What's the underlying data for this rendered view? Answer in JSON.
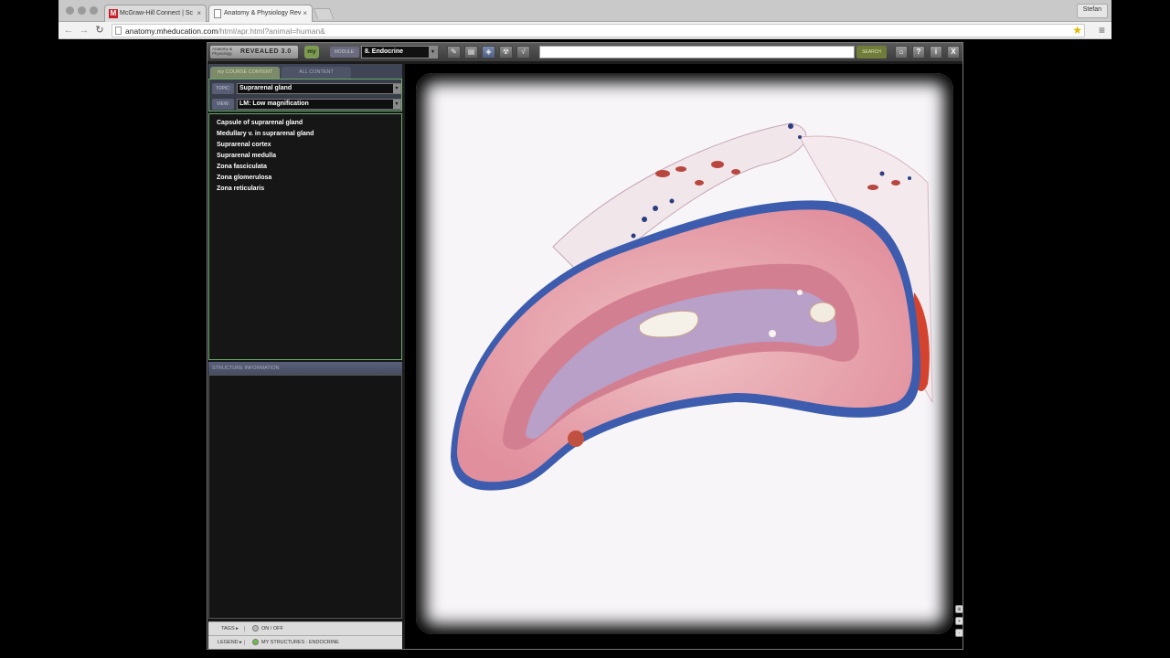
{
  "browser": {
    "tabs": [
      {
        "favicon": "M",
        "title": "McGraw-Hill Connect | Sc"
      },
      {
        "favicon": "page-icon",
        "title": "Anatomy & Physiology Rev"
      }
    ],
    "tab_close": "×",
    "user": "Stefan",
    "url_host": "anatomy.mheducation.com",
    "url_path": "/html/apr.html?animal=human&"
  },
  "app": {
    "logo_small": "Anatomy & Physiology",
    "logo_text": "REVEALED 3.0",
    "my_label": "my",
    "module_label": "MODULE:",
    "module_value": "8. Endocrine",
    "search_value": "",
    "search_button": "SEARCH",
    "right_buttons": [
      "⌂",
      "?",
      "i",
      "X"
    ]
  },
  "left": {
    "tabs": {
      "my": "my COURSE CONTENT",
      "all": "ALL CONTENT"
    },
    "topic_label": "TOPIC:",
    "topic_value": "Suprarenal gland",
    "view_label": "VIEW:",
    "view_value": "LM: Low magnification",
    "structures": [
      "Capsule of suprarenal gland",
      "Medullary v. in suprarenal gland",
      "Suprarenal cortex",
      "Suprarenal medulla",
      "Zona fasciculata",
      "Zona glomerulosa",
      "Zona reticularis"
    ],
    "info_header": "STRUCTURE INFORMATION",
    "tags_label": "TAGS ▸",
    "tags_value": "ON / OFF",
    "legend_label": "LEGEND ▸",
    "legend_value": "MY STRUCTURES :  ENDOCRINE"
  },
  "colors": {
    "cortex": "#e9a3ad",
    "capsule": "#3f5fb0",
    "medulla": "#b8a0c8",
    "accent_green": "#6aa86a"
  }
}
